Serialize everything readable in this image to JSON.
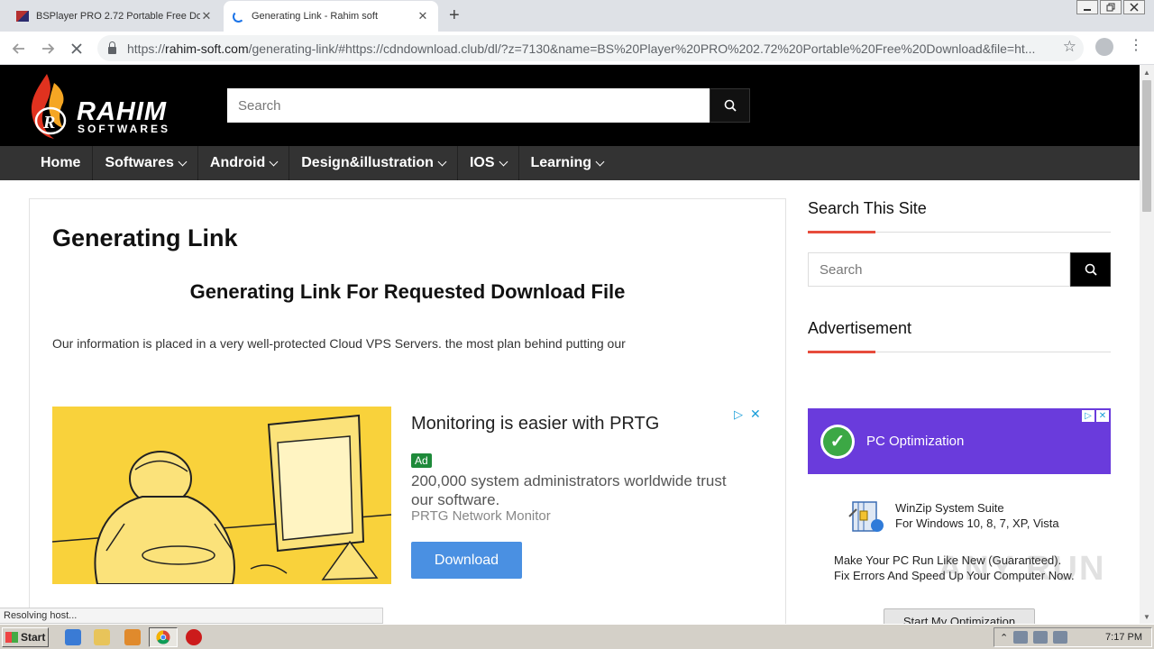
{
  "browser": {
    "tabs": [
      {
        "title": "BSPlayer PRO 2.72 Portable Free Do",
        "close": "✕"
      },
      {
        "title": "Generating Link - Rahim soft",
        "close": "✕"
      }
    ],
    "new_tab": "+",
    "url_scheme": "https://",
    "url_host": "rahim-soft.com",
    "url_rest": "/generating-link/#https://cdndownload.club/dl/?z=7130&name=BS%20Player%20PRO%202.72%20Portable%20Free%20Download&file=ht...",
    "status_text": "Resolving host..."
  },
  "site": {
    "logo_name": "RAHIM",
    "logo_sub": "SOFTWARES",
    "header_search_placeholder": "Search",
    "nav": [
      {
        "label": "Home",
        "dropdown": false
      },
      {
        "label": "Softwares",
        "dropdown": true
      },
      {
        "label": "Android",
        "dropdown": true
      },
      {
        "label": "Design&illustration",
        "dropdown": true
      },
      {
        "label": "IOS",
        "dropdown": true
      },
      {
        "label": "Learning",
        "dropdown": true
      }
    ]
  },
  "article": {
    "title": "Generating Link",
    "subtitle": "Generating Link For Requested Download File",
    "intro": "Our information is placed in a very well-protected Cloud VPS Servers. the most plan behind putting our"
  },
  "ad": {
    "headline": "Monitoring is easier with PRTG",
    "badge": "Ad",
    "body": "200,000 system administrators worldwide trust our software.",
    "source": "PRTG Network Monitor",
    "cta": "Download"
  },
  "sidebar": {
    "search_title": "Search This Site",
    "search_placeholder": "Search",
    "ad_title": "Advertisement",
    "banner_text": "PC Optimization",
    "product_name": "WinZip System Suite",
    "product_platforms": "For Windows 10, 8, 7, XP, Vista",
    "pitch_line1": "Make Your PC Run Like New (Guaranteed).",
    "pitch_line2": "Fix Errors And Speed Up Your Computer Now.",
    "cta": "Start My Optimization"
  },
  "watermark": "ANY RUN",
  "taskbar": {
    "start": "Start",
    "clock": "7:17 PM"
  },
  "colors": {
    "header_bg": "#000000",
    "nav_bg": "#333333",
    "accent": "#e74c3c",
    "ad_button": "#4a90e2",
    "banner_bg": "#6a3bdc"
  }
}
